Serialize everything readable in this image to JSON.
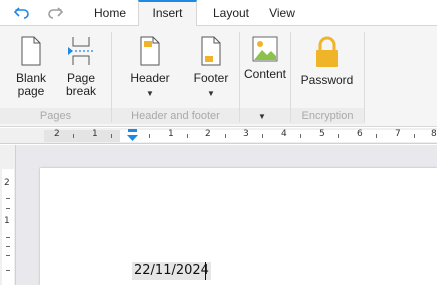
{
  "quick_access": {
    "undo_icon": "undo-arrow-icon",
    "redo_icon": "redo-arrow-icon"
  },
  "tabs": [
    {
      "label": "Home",
      "active": false
    },
    {
      "label": "Insert",
      "active": true
    },
    {
      "label": "Layout",
      "active": false
    },
    {
      "label": "View",
      "active": false
    }
  ],
  "ribbon": {
    "groups": [
      {
        "label": "Pages",
        "buttons": [
          {
            "label_line1": "Blank",
            "label_line2": "page",
            "icon": "blank-page-icon"
          },
          {
            "label_line1": "Page",
            "label_line2": "break",
            "icon": "page-break-icon"
          }
        ]
      },
      {
        "label": "Header and footer",
        "buttons": [
          {
            "label_line1": "Header",
            "icon": "header-icon",
            "dropdown": true
          },
          {
            "label_line1": "Footer",
            "icon": "footer-icon",
            "dropdown": true
          }
        ]
      },
      {
        "label": "",
        "buttons": [
          {
            "label_line1": "Content",
            "icon": "image-content-icon",
            "dropdown": true
          }
        ]
      },
      {
        "label": "Encryption",
        "buttons": [
          {
            "label_line1": "Password",
            "icon": "lock-icon"
          }
        ]
      }
    ]
  },
  "ruler": {
    "numbers": [
      "2",
      "1",
      "1",
      "2",
      "3",
      "4",
      "5",
      "6",
      "7",
      "8"
    ]
  },
  "vertical_ruler": {
    "numbers": [
      "2",
      "1"
    ]
  },
  "document": {
    "date_field": "22/11/2024"
  },
  "colors": {
    "accent": "#1e88e5",
    "icon_gold": "#f0b429",
    "icon_green": "#8bc34a"
  }
}
